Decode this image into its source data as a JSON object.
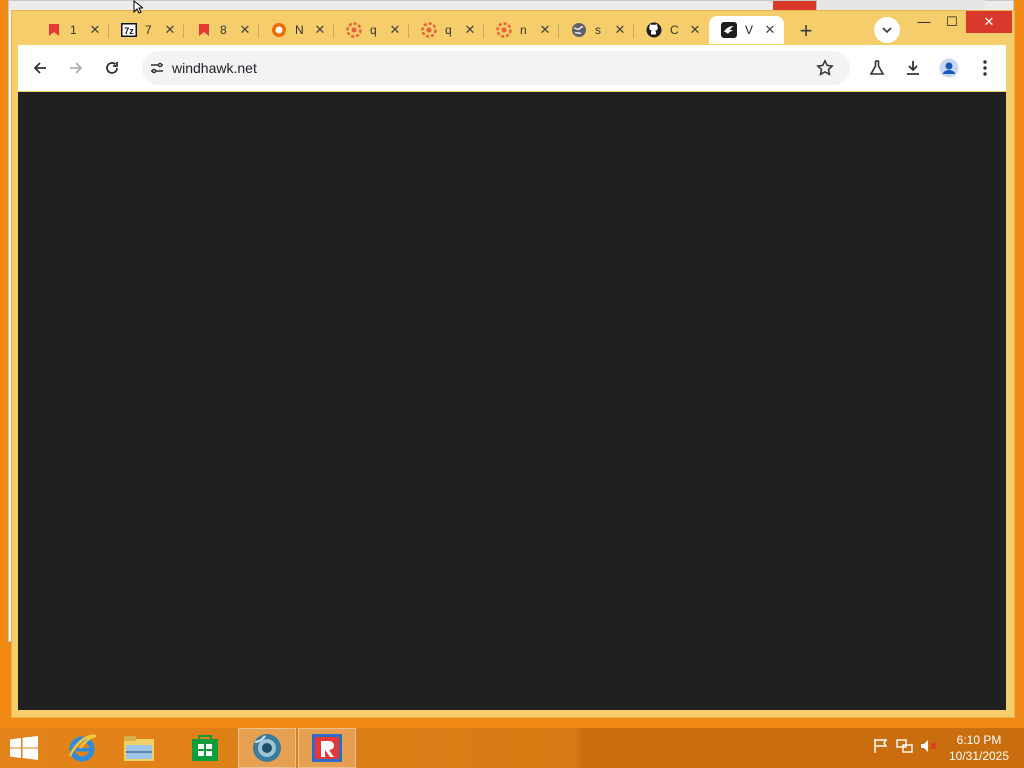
{
  "tabs": [
    {
      "title": "1",
      "icon": "red-bookmark-icon"
    },
    {
      "title": "7",
      "icon": "7zip-icon"
    },
    {
      "title": "8",
      "icon": "red-bookmark-icon"
    },
    {
      "title": "N",
      "icon": "orange-circle-icon"
    },
    {
      "title": "q",
      "icon": "orange-gear-icon"
    },
    {
      "title": "q",
      "icon": "orange-gear-icon"
    },
    {
      "title": "n",
      "icon": "orange-gear-icon"
    },
    {
      "title": "s",
      "icon": "globe-icon"
    },
    {
      "title": "C",
      "icon": "github-icon"
    },
    {
      "title": "V",
      "icon": "windhawk-icon"
    }
  ],
  "tab_close_glyph": "✕",
  "new_tab_glyph": "+",
  "window_controls": {
    "minimize": "—",
    "maximize": "☐",
    "close": "✕"
  },
  "omnibox": {
    "url": "windhawk.net"
  },
  "colors": {
    "desktop": "#f08a14",
    "chrome_frame": "#f5cd6a",
    "page_background": "#202020",
    "close_button": "#d9382b"
  },
  "taskbar": {
    "apps": [
      "start-button",
      "internet-explorer-icon",
      "file-explorer-icon",
      "store-icon",
      "chrome-icon",
      "roblox-studio-icon"
    ],
    "time": "6:10 PM",
    "date": "10/31/2025"
  },
  "tray": [
    "flag-icon",
    "network-icon",
    "volume-muted-icon"
  ]
}
